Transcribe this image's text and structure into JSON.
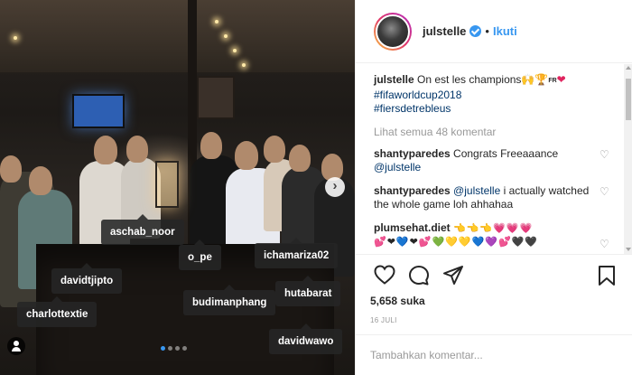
{
  "photo": {
    "tags": [
      {
        "name": "aschab_noor"
      },
      {
        "name": "o_pe"
      },
      {
        "name": "ichamariza02"
      },
      {
        "name": "davidtjipto"
      },
      {
        "name": "budimanphang"
      },
      {
        "name": "hutabarat"
      },
      {
        "name": "charlottextie"
      },
      {
        "name": "davidwawo"
      }
    ],
    "next_icon": "chevron-right-icon",
    "carousel": {
      "total": 4,
      "active": 1
    }
  },
  "header": {
    "username": "julstelle",
    "separator": "•",
    "follow_label": "Ikuti"
  },
  "caption": {
    "username": "julstelle",
    "text": "On est les champions",
    "flag_text": "FR",
    "hashtags": [
      "#fifaworldcup2018",
      "#fiersdetrebleus"
    ]
  },
  "view_all_label": "Lihat semua 48 komentar",
  "comments": [
    {
      "username": "shantyparedes",
      "text": "Congrats Freeaaance",
      "mention": "@julstelle",
      "tail": ""
    },
    {
      "username": "shantyparedes",
      "text": "",
      "mention": "@julstelle",
      "tail": "i actually watched the whole game loh ahhahaa"
    },
    {
      "username": "plumsehat.diet",
      "text": "👈👈👈💗💗💗",
      "mention": "",
      "tail": "💕❤💙❤💕💚💛💛💙💜💕🖤🖤"
    }
  ],
  "likes_label": "5,658 suka",
  "date_label": "16 JULI",
  "add_comment_placeholder": "Tambahkan komentar...",
  "colors": {
    "link": "#3897f0",
    "hashtag": "#003569",
    "muted": "#999999"
  }
}
